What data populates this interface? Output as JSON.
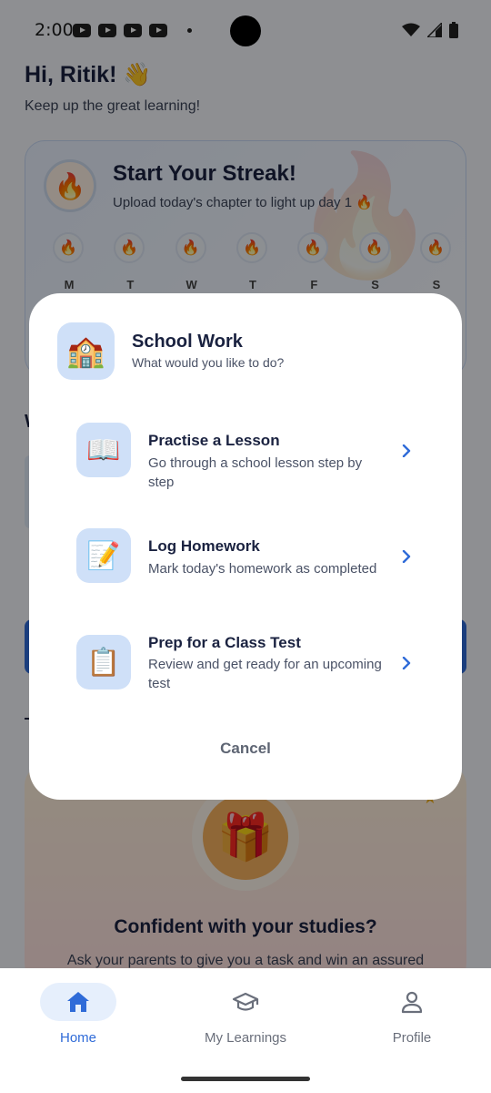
{
  "status_bar": {
    "time": "2:00"
  },
  "header": {
    "greeting": "Hi, Ritik! 👋",
    "subtitle": "Keep up the great learning!"
  },
  "streak": {
    "icon": "🔥",
    "title": "Start Your Streak!",
    "subtitle": "Upload today's chapter to light up day 1 🔥",
    "days": [
      {
        "letter": "M",
        "icon": "🔥"
      },
      {
        "letter": "T",
        "icon": "🔥"
      },
      {
        "letter": "W",
        "icon": "🔥"
      },
      {
        "letter": "T",
        "icon": "🔥"
      },
      {
        "letter": "F",
        "icon": "🔥"
      },
      {
        "letter": "S",
        "icon": "🔥"
      },
      {
        "letter": "S",
        "icon": "🔥"
      }
    ]
  },
  "background_peek": {
    "letter": "W",
    "dash": "-"
  },
  "promo": {
    "icon": "🎁",
    "star": "★",
    "title": "Confident with your studies?",
    "subtitle": "Ask your parents to give you a task and win an assured"
  },
  "modal": {
    "icon": "🏫",
    "title": "School Work",
    "subtitle": "What would you like to do?",
    "options": [
      {
        "icon": "📖",
        "title": "Practise a Lesson",
        "description": "Go through a school lesson step by step"
      },
      {
        "icon": "📝",
        "title": "Log Homework",
        "description": "Mark today's homework as completed"
      },
      {
        "icon": "📋",
        "title": "Prep for a Class Test",
        "description": "Review and get ready for an upcoming test"
      }
    ],
    "cancel_label": "Cancel"
  },
  "bottom_nav": {
    "items": [
      {
        "label": "Home",
        "icon": "home-icon",
        "active": true
      },
      {
        "label": "My Learnings",
        "icon": "graduation-cap-icon",
        "active": false
      },
      {
        "label": "Profile",
        "icon": "person-icon",
        "active": false
      }
    ]
  },
  "colors": {
    "accent": "#2f6bd8",
    "title_text": "#1a2240",
    "icon_tile": "#cfe0f8"
  }
}
